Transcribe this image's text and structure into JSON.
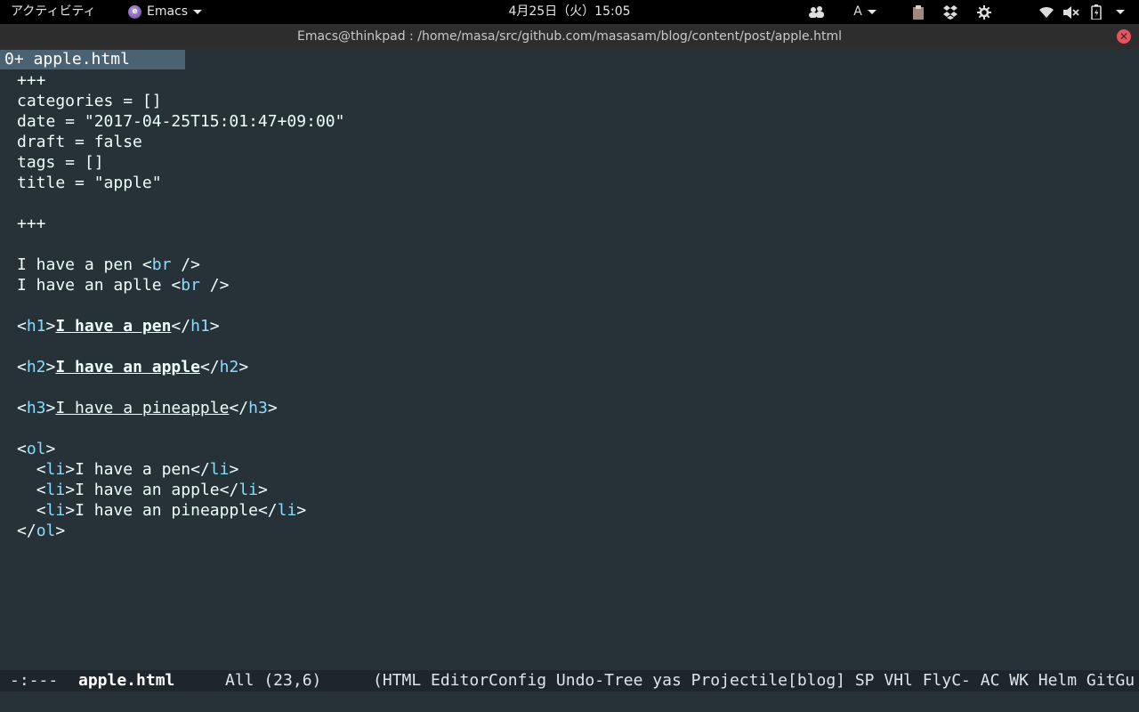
{
  "topbar": {
    "activities": "アクティビティ",
    "app_name": "Emacs",
    "app_icon_letter": "e",
    "clock": "4月25日（火）15:05",
    "input_method": "A",
    "tray_icons": [
      "people-icon",
      "input-method-icon",
      "clipboard-icon",
      "dropbox-icon",
      "settings-icon",
      "wifi-icon",
      "volume-muted-icon",
      "battery-icon",
      "system-menu-icon"
    ]
  },
  "window": {
    "title": "Emacs@thinkpad : /home/masa/src/github.com/masasam/blog/content/post/apple.html",
    "close_glyph": "✕"
  },
  "tabs": [
    {
      "number": "0+",
      "label": "apple.html",
      "active": true
    }
  ],
  "buffer": {
    "lines": [
      "+++",
      "categories = []",
      "date = \"2017-04-25T15:01:47+09:00\"",
      "draft = false",
      "tags = []",
      "title = \"apple\"",
      "",
      "+++",
      "",
      "I have a pen <br />",
      "I have an aplle <br />",
      "",
      "<h1>I have a pen</h1>",
      "",
      "<h2>I have an apple</h2>",
      "",
      "<h3>I have a pineapple</h3>",
      "",
      "<ol>",
      "  <li>I have a pen</li>",
      "  <li>I have an apple</li>",
      "  <li>I have an pineapple</li>",
      "</ol>"
    ],
    "colors": {
      "background": "#263238",
      "text": "#eeffff",
      "tag": "#89ddff"
    }
  },
  "modeline": {
    "status": "-:---",
    "buffer_name": "apple.html",
    "position": "All (23,6)",
    "modes": "(HTML EditorConfig Undo-Tree yas Projectile[blog] SP VHl FlyC- AC WK Helm GitGu"
  }
}
